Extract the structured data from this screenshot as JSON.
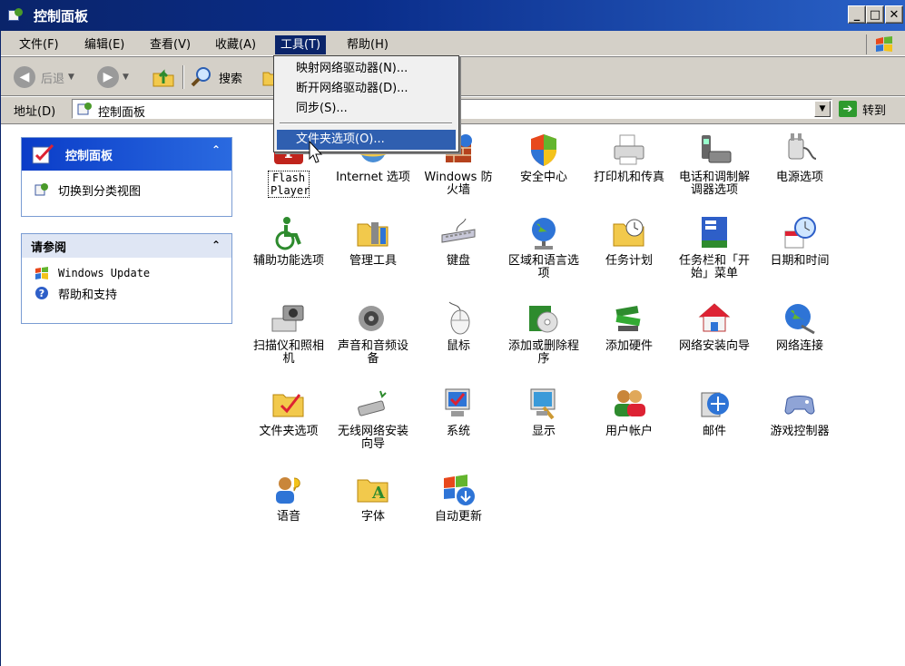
{
  "window": {
    "title": "控制面板"
  },
  "menubar": {
    "items": [
      {
        "label": "文件(F)"
      },
      {
        "label": "编辑(E)"
      },
      {
        "label": "查看(V)"
      },
      {
        "label": "收藏(A)"
      },
      {
        "label": "工具(T)",
        "active": true
      },
      {
        "label": "帮助(H)"
      }
    ]
  },
  "toolbar": {
    "back_label": "后退",
    "search_label": "搜索"
  },
  "address": {
    "label": "地址(D)",
    "value": "控制面板",
    "go_label": "转到"
  },
  "tools_menu": {
    "items": [
      {
        "label": "映射网络驱动器(N)..."
      },
      {
        "label": "断开网络驱动器(D)..."
      },
      {
        "label": "同步(S)..."
      },
      {
        "label": "文件夹选项(O)...",
        "highlighted": true
      }
    ]
  },
  "sidebar": {
    "control_panel": {
      "title": "控制面板",
      "links": [
        {
          "label": "切换到分类视图"
        }
      ]
    },
    "see_also": {
      "title": "请参阅",
      "links": [
        {
          "label": "Windows Update"
        },
        {
          "label": "帮助和支持"
        }
      ]
    }
  },
  "icons": [
    {
      "label": "Flash Player",
      "icon": "flash-icon"
    },
    {
      "label": "Internet 选项",
      "icon": "internet-options-icon"
    },
    {
      "label": "Windows 防火墙",
      "icon": "firewall-icon"
    },
    {
      "label": "安全中心",
      "icon": "security-shield-icon"
    },
    {
      "label": "打印机和传真",
      "icon": "printer-icon"
    },
    {
      "label": "电话和调制解调器选项",
      "icon": "phone-modem-icon"
    },
    {
      "label": "电源选项",
      "icon": "power-icon"
    },
    {
      "label": "辅助功能选项",
      "icon": "accessibility-icon"
    },
    {
      "label": "管理工具",
      "icon": "admin-tools-icon"
    },
    {
      "label": "键盘",
      "icon": "keyboard-icon"
    },
    {
      "label": "区域和语言选项",
      "icon": "globe-icon"
    },
    {
      "label": "任务计划",
      "icon": "scheduled-tasks-icon"
    },
    {
      "label": "任务栏和「开始」菜单",
      "icon": "taskbar-icon"
    },
    {
      "label": "日期和时间",
      "icon": "clock-icon"
    },
    {
      "label": "扫描仪和照相机",
      "icon": "scanner-camera-icon"
    },
    {
      "label": "声音和音频设备",
      "icon": "speaker-icon"
    },
    {
      "label": "鼠标",
      "icon": "mouse-icon"
    },
    {
      "label": "添加或删除程序",
      "icon": "add-remove-programs-icon"
    },
    {
      "label": "添加硬件",
      "icon": "add-hardware-icon"
    },
    {
      "label": "网络安装向导",
      "icon": "network-setup-icon"
    },
    {
      "label": "网络连接",
      "icon": "network-connections-icon"
    },
    {
      "label": "文件夹选项",
      "icon": "folder-options-icon"
    },
    {
      "label": "无线网络安装向导",
      "icon": "wireless-icon"
    },
    {
      "label": "系统",
      "icon": "system-icon"
    },
    {
      "label": "显示",
      "icon": "display-icon"
    },
    {
      "label": "用户帐户",
      "icon": "user-accounts-icon"
    },
    {
      "label": "邮件",
      "icon": "mail-icon"
    },
    {
      "label": "游戏控制器",
      "icon": "game-controller-icon"
    },
    {
      "label": "语音",
      "icon": "speech-icon"
    },
    {
      "label": "字体",
      "icon": "fonts-icon"
    },
    {
      "label": "自动更新",
      "icon": "auto-update-icon"
    }
  ],
  "colors": {
    "titlebar": "#0a246a",
    "menu_highlight": "#2f5fb0",
    "panel_header": "#0a3cc8"
  }
}
